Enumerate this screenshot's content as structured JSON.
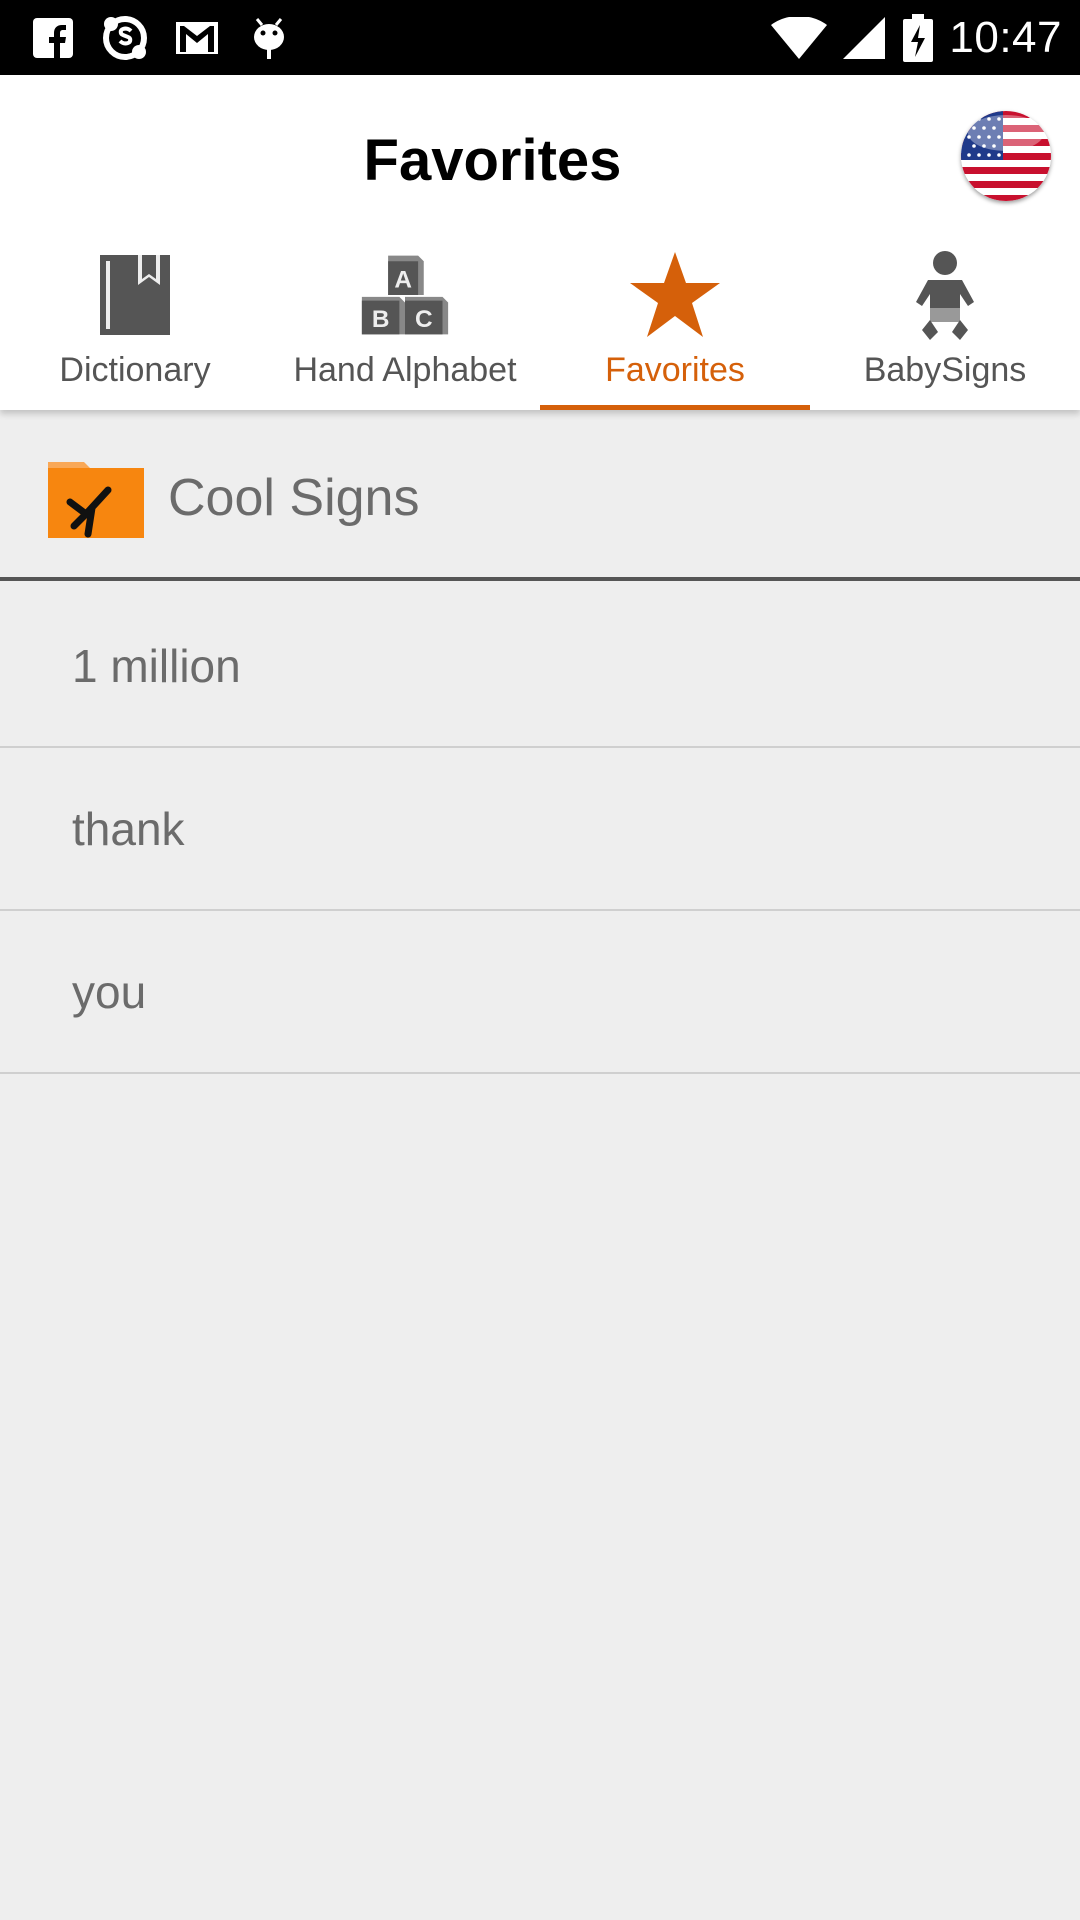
{
  "status_bar": {
    "time": "10:47",
    "left_icons": [
      "facebook-icon",
      "skype-icon",
      "gmail-icon",
      "android-debug-icon"
    ],
    "right_icons": [
      "wifi-icon",
      "cell-signal-icon",
      "battery-charging-icon"
    ]
  },
  "header": {
    "title": "Favorites",
    "language_flag": "us-flag-icon"
  },
  "tabs": [
    {
      "label": "Dictionary",
      "icon": "book-icon",
      "active": false
    },
    {
      "label": "Hand Alphabet",
      "icon": "abc-blocks-icon",
      "active": false
    },
    {
      "label": "Favorites",
      "icon": "star-icon",
      "active": true
    },
    {
      "label": "BabySigns",
      "icon": "baby-icon",
      "active": false
    }
  ],
  "folder": {
    "label": "Cool Signs",
    "icon": "folder-icon"
  },
  "list": {
    "items": [
      {
        "label": "1 million"
      },
      {
        "label": "thank"
      },
      {
        "label": "you"
      }
    ]
  },
  "colors": {
    "accent": "#d5600a",
    "folder_orange": "#f7860f",
    "background": "#eeeeee",
    "text_gray": "#6b6b6b"
  }
}
